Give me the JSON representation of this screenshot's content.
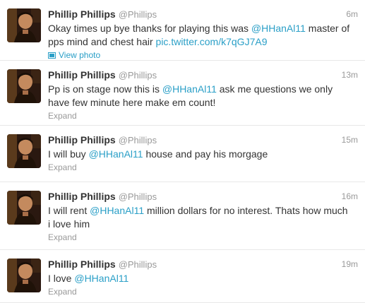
{
  "tweets": [
    {
      "name": "Phillip Phillips",
      "handle": "@Phillips",
      "time": "6m",
      "text_pre": "Okay times up bye thanks for playing this was ",
      "mention": "@HHanAl11",
      "text_post": " master of pps mind and chest hair ",
      "link": "pic.twitter.com/k7qGJ7A9",
      "action": "View photo",
      "action_icon": "photo-icon"
    },
    {
      "name": "Phillip Phillips",
      "handle": "@Phillips",
      "time": "13m",
      "text_pre": "Pp is on stage now this is ",
      "mention": "@HHanAl11",
      "text_post": " ask me questions we only have few minute here make em count!",
      "action": "Expand"
    },
    {
      "name": "Phillip Phillips",
      "handle": "@Phillips",
      "time": "15m",
      "text_pre": "I will buy ",
      "mention": "@HHanAl11",
      "text_post": " house and pay his morgage",
      "action": "Expand"
    },
    {
      "name": "Phillip Phillips",
      "handle": "@Phillips",
      "time": "16m",
      "text_pre": "I will rent ",
      "mention": "@HHanAl11",
      "text_post": " million dollars for no interest. Thats how much i love him",
      "action": "Expand"
    },
    {
      "name": "Phillip Phillips",
      "handle": "@Phillips",
      "time": "19m",
      "text_pre": "I love ",
      "mention": "@HHanAl11",
      "text_post": "",
      "action": "Expand"
    }
  ],
  "colors": {
    "link": "#2a9fc7",
    "muted": "#999999",
    "text": "#333333",
    "divider": "#e8e8e8"
  }
}
